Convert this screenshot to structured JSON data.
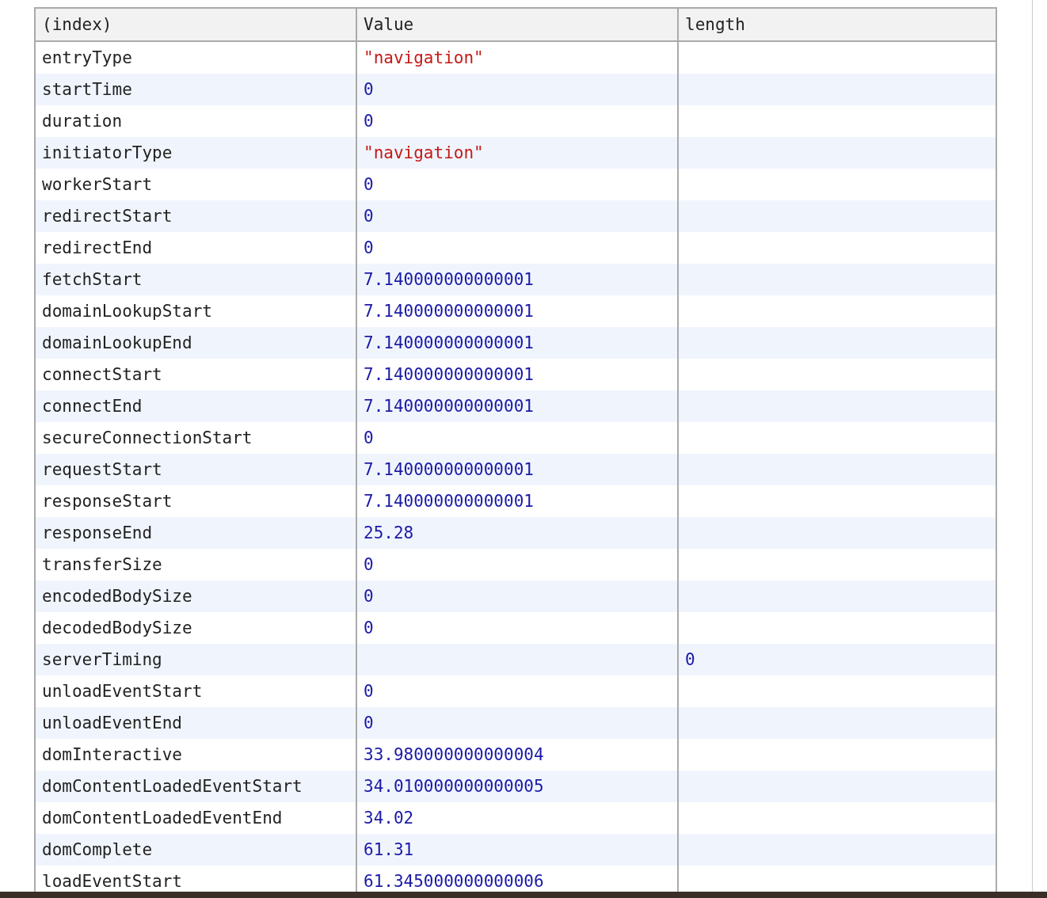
{
  "table": {
    "columns": [
      "(index)",
      "Value",
      "length"
    ],
    "rows": [
      {
        "index": "entryType",
        "value": "\"navigation\"",
        "kind": "string"
      },
      {
        "index": "startTime",
        "value": "0",
        "kind": "number"
      },
      {
        "index": "duration",
        "value": "0",
        "kind": "number"
      },
      {
        "index": "initiatorType",
        "value": "\"navigation\"",
        "kind": "string"
      },
      {
        "index": "workerStart",
        "value": "0",
        "kind": "number"
      },
      {
        "index": "redirectStart",
        "value": "0",
        "kind": "number"
      },
      {
        "index": "redirectEnd",
        "value": "0",
        "kind": "number"
      },
      {
        "index": "fetchStart",
        "value": "7.140000000000001",
        "kind": "number"
      },
      {
        "index": "domainLookupStart",
        "value": "7.140000000000001",
        "kind": "number"
      },
      {
        "index": "domainLookupEnd",
        "value": "7.140000000000001",
        "kind": "number"
      },
      {
        "index": "connectStart",
        "value": "7.140000000000001",
        "kind": "number"
      },
      {
        "index": "connectEnd",
        "value": "7.140000000000001",
        "kind": "number"
      },
      {
        "index": "secureConnectionStart",
        "value": "0",
        "kind": "number"
      },
      {
        "index": "requestStart",
        "value": "7.140000000000001",
        "kind": "number"
      },
      {
        "index": "responseStart",
        "value": "7.140000000000001",
        "kind": "number"
      },
      {
        "index": "responseEnd",
        "value": "25.28",
        "kind": "number"
      },
      {
        "index": "transferSize",
        "value": "0",
        "kind": "number"
      },
      {
        "index": "encodedBodySize",
        "value": "0",
        "kind": "number"
      },
      {
        "index": "decodedBodySize",
        "value": "0",
        "kind": "number"
      },
      {
        "index": "serverTiming",
        "length": "0",
        "kind": "number"
      },
      {
        "index": "unloadEventStart",
        "value": "0",
        "kind": "number"
      },
      {
        "index": "unloadEventEnd",
        "value": "0",
        "kind": "number"
      },
      {
        "index": "domInteractive",
        "value": "33.980000000000004",
        "kind": "number"
      },
      {
        "index": "domContentLoadedEventStart",
        "value": "34.010000000000005",
        "kind": "number"
      },
      {
        "index": "domContentLoadedEventEnd",
        "value": "34.02",
        "kind": "number"
      },
      {
        "index": "domComplete",
        "value": "61.31",
        "kind": "number"
      },
      {
        "index": "loadEventStart",
        "value": "61.345000000000006",
        "kind": "number"
      }
    ]
  }
}
